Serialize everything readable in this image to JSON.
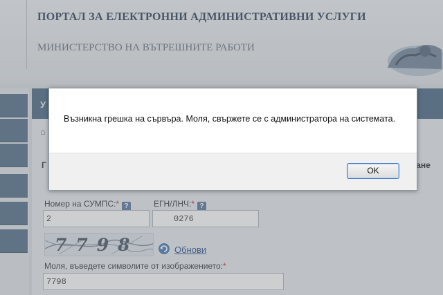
{
  "header": {
    "portal_title": "ПОРТАЛ ЗА ЕЛЕКТРОННИ АДМИНИСТРАТИВНИ УСЛУГИ",
    "ministry_title": "МИНИСТЕРСТВО НА ВЪТРЕШНИТЕ РАБОТИ"
  },
  "content": {
    "band_stub": "У",
    "home_icon": "⌂",
    "left_stub": "Г",
    "right_stub": "ване"
  },
  "form": {
    "sumps_label": "Номер на СУМПС:",
    "egn_label": "ЕГН/ЛНЧ:",
    "required_mark": "*",
    "help_glyph": "?",
    "sumps_value_visible": "2",
    "egn_value_visible": "0276",
    "captcha_text": "7798",
    "refresh_label": "Обнови",
    "captcha_prompt": "Моля, въведете символите от изображението:",
    "captcha_value": "7798"
  },
  "dialog": {
    "message": "Възникна грешка на сървъра. Моля, свържете се с администратора на системата.",
    "ok_label": "OK"
  },
  "icons": {
    "help": "help-icon",
    "refresh": "refresh-icon",
    "home": "home-icon"
  },
  "colors": {
    "nav_blue": "#4f6c86",
    "band_blue": "#496683",
    "required_red": "#d21d1d",
    "link_blue": "#214c8a",
    "ok_border": "#3d7bca"
  }
}
